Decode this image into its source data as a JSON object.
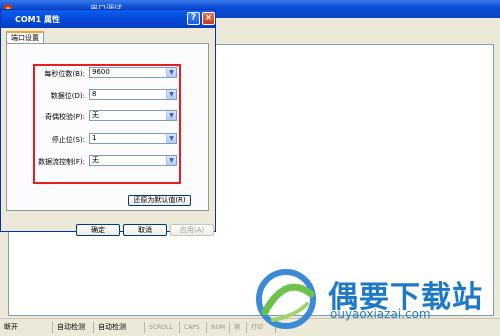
{
  "background_window": {
    "title": "串口调试"
  },
  "status_bar": {
    "items": [
      "断开",
      "自动检测",
      "自动检测",
      "SCROLL",
      "CAPS",
      "NUM",
      "捕",
      "打印"
    ]
  },
  "dialog": {
    "title": "COM1 属性",
    "tab": "端口设置",
    "fields": [
      {
        "label": "每秒位数(B):",
        "value": "9600"
      },
      {
        "label": "数据位(D):",
        "value": "8"
      },
      {
        "label": "奇偶校验(P):",
        "value": "无"
      },
      {
        "label": "停止位(S):",
        "value": "1"
      },
      {
        "label": "数据流控制(F):",
        "value": "无"
      }
    ],
    "restore_label": "还原为默认值(R)",
    "ok_label": "确定",
    "cancel_label": "取消",
    "apply_label": "应用(A)"
  },
  "watermark": {
    "brand": "偶要下载站",
    "url": "ouyaoxiazai.com"
  },
  "colors": {
    "highlight": "#e51e1e",
    "titlebar": "#0648d8",
    "watermark": "#1e78c8"
  }
}
